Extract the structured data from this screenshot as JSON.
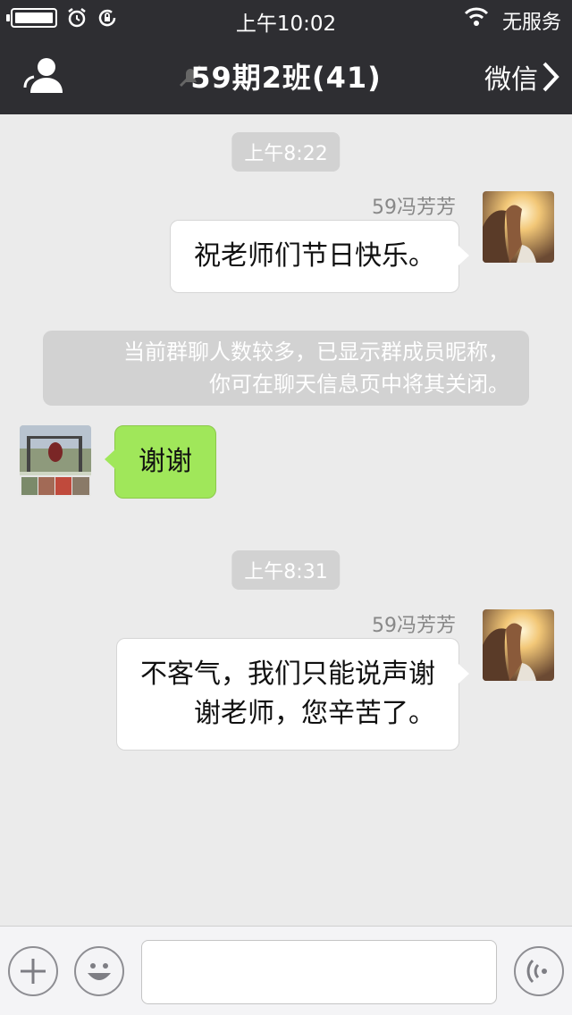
{
  "status": {
    "carrier": "无服务",
    "time": "上午10:02"
  },
  "nav": {
    "title": "59期2班(41)",
    "back_label": "微信"
  },
  "chat": {
    "timestamp_1": "上午8:22",
    "msg1": {
      "sender": "59冯芳芳",
      "text": "祝老师们节日快乐。"
    },
    "system_note": {
      "line1": "当前群聊人数较多，已显示群成员昵称，",
      "line2": "你可在聊天信息页中将其关闭。"
    },
    "msg2": {
      "text": "谢谢"
    },
    "timestamp_2": "上午8:31",
    "msg3": {
      "sender": "59冯芳芳",
      "line1": "不客气，我们只能说声谢",
      "line2": "谢老师，您辛苦了。"
    }
  },
  "input": {
    "placeholder": ""
  },
  "colors": {
    "nav_bg": "#2e2e32",
    "chat_bg": "#ebebeb",
    "self_bubble": "#a0e75a"
  }
}
